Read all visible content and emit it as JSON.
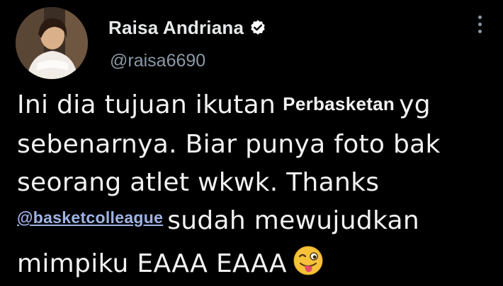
{
  "user": {
    "display_name": "Raisa Andriana",
    "handle": "@raisa6690",
    "verified_icon": "verified-badge-icon",
    "avatar_icon": "profile-photo"
  },
  "menu": {
    "icon": "more-vertical-icon"
  },
  "tweet": {
    "line1_a": "Ini dia tujuan ikutan",
    "line1_bold": "Perbasketan",
    "line1_b": "yg",
    "line2": "sebenarnya. Biar punya foto bak",
    "line3": "seorang atlet wkwk. Thanks",
    "line4_mention": "@basketcolleague",
    "line4_rest": "sudah mewujudkan",
    "line5": "mimpiku EAAA EAAA",
    "emoji_icon": "winking-face-tongue-icon"
  },
  "colors": {
    "background": "#000000",
    "text": "#e7e9ea",
    "secondary": "#8b98a5",
    "mention": "#9fb4e6"
  }
}
